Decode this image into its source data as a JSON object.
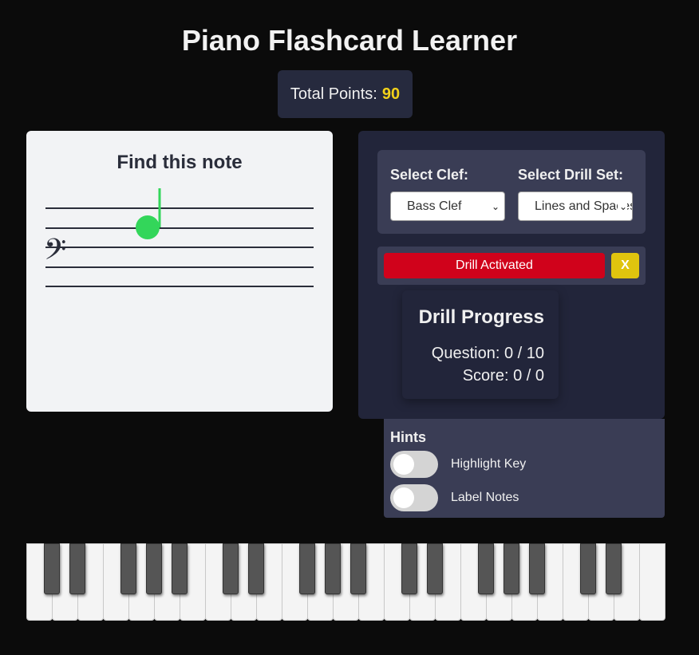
{
  "app": {
    "title": "Piano Flashcard Learner"
  },
  "points": {
    "label": "Total Points:",
    "value": "90",
    "value_color": "#f2d21a"
  },
  "flashcard": {
    "title": "Find this note",
    "clef_symbol": "𝄢",
    "clef_icon": "bass-clef-icon",
    "note_color": "#33d65a"
  },
  "controls": {
    "clef_label": "Select Clef:",
    "clef_value": "Bass Clef",
    "drill_label": "Select Drill Set:",
    "drill_value": "Lines and Spaces",
    "drill_button": "Drill Activated",
    "drill_button_color": "#d0021b",
    "close_button": "X",
    "close_button_color": "#e0c40e"
  },
  "progress": {
    "title": "Drill Progress",
    "question": "Question: 0 / 10",
    "score": "Score: 0 / 0"
  },
  "hints": {
    "title": "Hints",
    "highlight_key": {
      "label": "Highlight Key",
      "on": false
    },
    "label_notes": {
      "label": "Label Notes",
      "on": false
    }
  },
  "piano": {
    "white_keys": 25,
    "black_key_pattern": [
      1,
      1,
      0,
      1,
      1,
      1,
      0
    ]
  }
}
